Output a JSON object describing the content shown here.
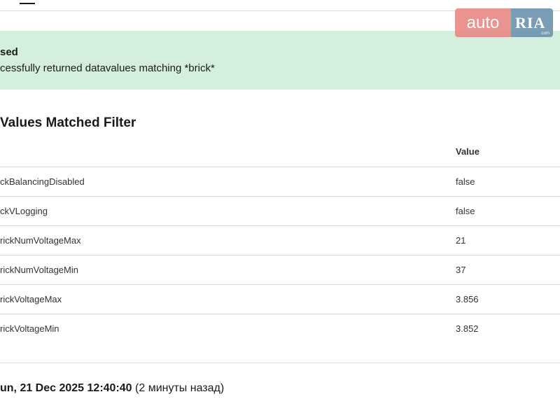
{
  "alert": {
    "title": "sed",
    "message": "cessfully returned datavalues matching *brick*"
  },
  "section": {
    "title": "Values Matched Filter"
  },
  "table": {
    "header_value": "Value",
    "rows": [
      {
        "name": "ckBalancingDisabled",
        "value": "false"
      },
      {
        "name": "ckVLogging",
        "value": "false"
      },
      {
        "name": "rickNumVoltageMax",
        "value": "21"
      },
      {
        "name": "rickNumVoltageMin",
        "value": "37"
      },
      {
        "name": "rickVoltageMax",
        "value": "3.856"
      },
      {
        "name": "rickVoltageMin",
        "value": "3.852"
      }
    ]
  },
  "footer": {
    "datetime": "un, 21 Dec 2025 12:40:40",
    "relative": "(2 минуты назад)"
  },
  "watermark": {
    "auto": "auto",
    "ria": "RIA",
    "com": ".com"
  }
}
